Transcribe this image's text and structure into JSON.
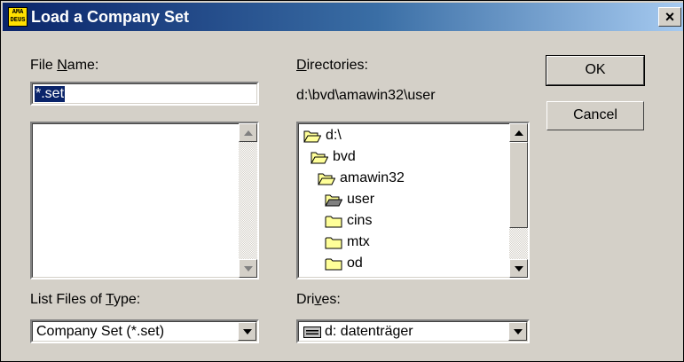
{
  "window": {
    "title": "Load a Company Set",
    "app_icon_text": "AMADEUS",
    "close_label": "×"
  },
  "file_name": {
    "label_pre": "File ",
    "label_key": "N",
    "label_post": "ame:",
    "value": "*.set",
    "files": []
  },
  "directories": {
    "label_key": "D",
    "label_post": "irectories:",
    "current_path": "d:\\bvd\\amawin32\\user",
    "items": [
      {
        "name": "d:\\",
        "state": "open"
      },
      {
        "name": "bvd",
        "state": "open"
      },
      {
        "name": "amawin32",
        "state": "open"
      },
      {
        "name": "user",
        "state": "open-selected"
      },
      {
        "name": "cins",
        "state": "closed"
      },
      {
        "name": "mtx",
        "state": "closed"
      },
      {
        "name": "od",
        "state": "closed"
      }
    ]
  },
  "file_type": {
    "label_pre": "List Files of ",
    "label_key": "T",
    "label_post": "ype:",
    "selected": "Company Set (*.set)"
  },
  "drives": {
    "label_pre": "Dri",
    "label_key": "v",
    "label_post": "es:",
    "selected": "d: datenträger"
  },
  "buttons": {
    "ok": "OK",
    "cancel": "Cancel"
  }
}
